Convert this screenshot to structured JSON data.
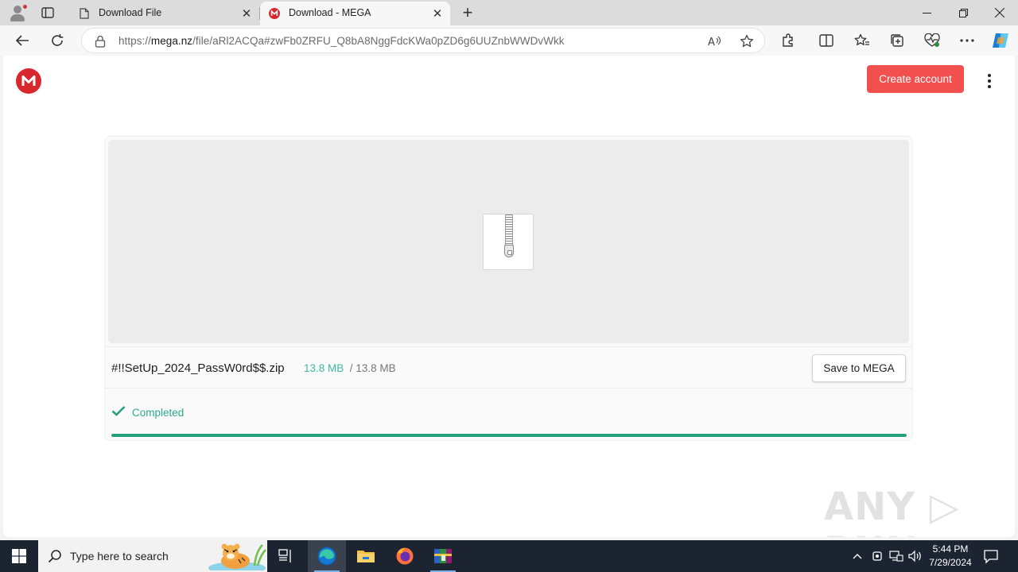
{
  "browser": {
    "tabs": [
      {
        "title": "Download File",
        "icon": "page-icon",
        "active": false
      },
      {
        "title": "Download - MEGA",
        "icon": "mega-favicon",
        "active": true
      }
    ],
    "new_tab": "+",
    "window_controls": {
      "minimize": "—",
      "restore": "❐",
      "close": "✕"
    },
    "address": {
      "scheme": "https://",
      "host": "mega.nz",
      "path": "/file/aRl2ACQa#zwFb0ZRFU_Q8bA8NggFdcKWa0pZD6g6UUZnbWWDvWkk"
    }
  },
  "page": {
    "header": {
      "create_account": "Create account"
    },
    "file": {
      "name": "#!!SetUp_2024_PassW0rd$$.zip",
      "downloaded": "13.8 MB",
      "separator": "/",
      "total": "13.8 MB",
      "save_button": "Save to MEGA"
    },
    "status": {
      "text": "Completed",
      "progress_percent": 100
    },
    "watermark": "ANY ▷ RUN"
  },
  "taskbar": {
    "search_placeholder": "Type here to search",
    "apps": [
      "task-view",
      "edge",
      "file-explorer",
      "firefox",
      "winrar"
    ],
    "clock": {
      "time": "5:44 PM",
      "date": "7/29/2024"
    }
  },
  "colors": {
    "mega_red": "#d9272e",
    "create_button": "#f24f4f",
    "progress": "#24a07d",
    "completed_text": "#2fa98d",
    "downloaded_size": "#3fb8a1"
  }
}
